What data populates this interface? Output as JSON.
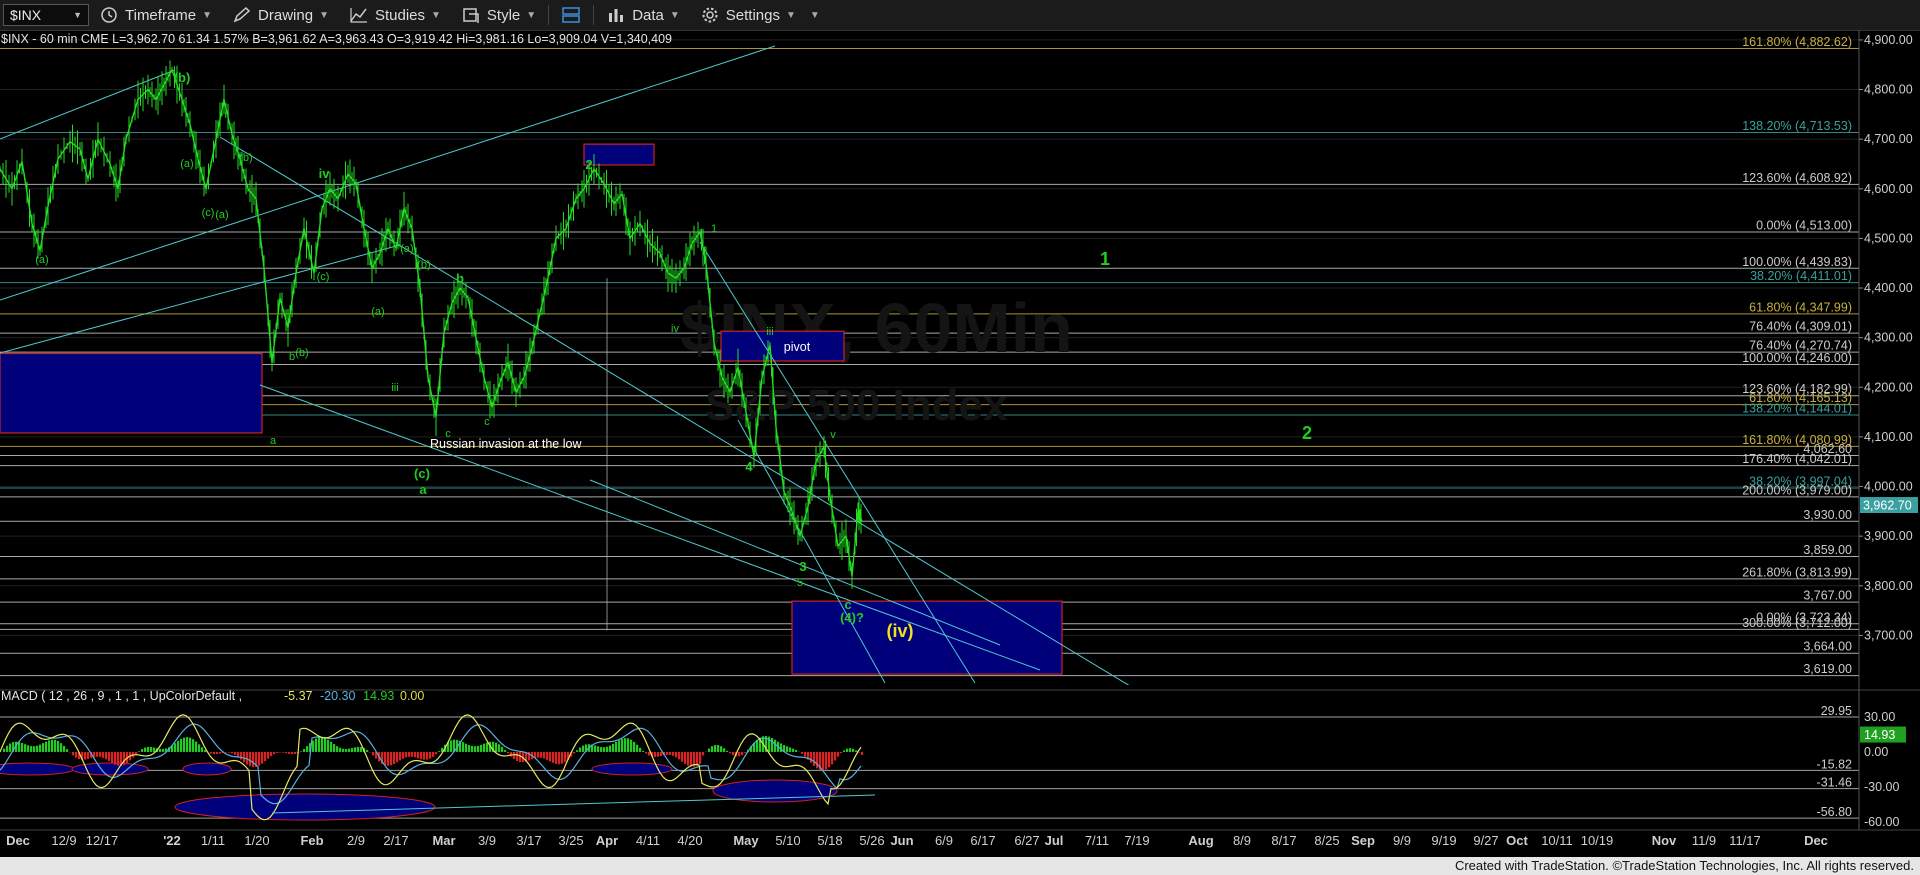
{
  "toolbar": {
    "symbol": "$INX",
    "timeframe_label": "Timeframe",
    "drawing_label": "Drawing",
    "studies_label": "Studies",
    "style_label": "Style",
    "data_label": "Data",
    "settings_label": "Settings"
  },
  "chart_header": {
    "text": "$INX - 60 min  CME  L=3,962.70  61.34  1.57%  B=3,961.62  A=3,963.43  O=3,919.42  Hi=3,981.16  Lo=3,909.04  V=1,340,409"
  },
  "watermark": {
    "line1": "$INX, 60Min",
    "line2": "S&P 500 Index"
  },
  "macd_header": {
    "label": "MACD ( 12 , 26 , 9 , 1 , 1 , UpColorDefault ,",
    "v1": "-5.37",
    "v2": "-20.30",
    "v3": "14.93",
    "v4": "0.00"
  },
  "footer": {
    "text": "Created with TradeStation. ©TradeStation Technologies, Inc. All rights reserved."
  },
  "colors": {
    "price": "#22dd22",
    "fib_line": "#c8c8c8",
    "fib_label": "#cccccc",
    "fib_gold": "#c8b040",
    "fib_teal": "#3aa0a0",
    "trend": "#4fc8d0",
    "box_fill": "#00007a",
    "box_border": "#cc2222",
    "wave_green": "#22cc22",
    "macd_line": "#e8e860",
    "macd_signal": "#5ab0e0",
    "hist_up": "#22cc22",
    "hist_down": "#dd2222"
  },
  "chart_data": {
    "type": "line",
    "title": "$INX, 60Min",
    "subtitle": "S&P 500 Index",
    "price_axis": {
      "ylim": [
        3600,
        4920
      ],
      "ticks": [
        3700,
        3800,
        3900,
        4000,
        4100,
        4200,
        4300,
        4400,
        4500,
        4600,
        4700,
        4800,
        4900
      ],
      "tick_labels": [
        "3,700.00",
        "3,800.00",
        "3,900.00",
        "4,000.00",
        "4,100.00",
        "4,200.00",
        "4,300.00",
        "4,400.00",
        "4,500.00",
        "4,600.00",
        "4,700.00",
        "4,800.00",
        "4,900.00"
      ],
      "last_price": {
        "value": 3962.7,
        "label": "3,962.70"
      }
    },
    "x_axis": {
      "tick_labels": [
        "Dec",
        "12/9",
        "12/17",
        "'22",
        "1/11",
        "1/20",
        "Feb",
        "2/9",
        "2/17",
        "Mar",
        "3/9",
        "3/17",
        "3/25",
        "Apr",
        "4/11",
        "4/20",
        "May",
        "5/10",
        "5/18",
        "5/26",
        "Jun",
        "6/9",
        "6/17",
        "6/27",
        "Jul",
        "7/11",
        "7/19",
        "Aug",
        "8/9",
        "8/17",
        "8/25",
        "Sep",
        "9/9",
        "9/19",
        "9/27",
        "Oct",
        "10/11",
        "10/19",
        "Nov",
        "11/9",
        "11/17",
        "Dec"
      ],
      "bold_labels": [
        "'22",
        "Feb",
        "Mar",
        "Apr",
        "May",
        "Jun",
        "Jul",
        "Aug",
        "Sep",
        "Oct",
        "Nov",
        "Dec"
      ]
    },
    "fib_levels": [
      {
        "value": 4882.62,
        "label": "161.80% (4,882.62)",
        "color": "gold"
      },
      {
        "value": 4713.53,
        "label": "138.20% (4,713.53)",
        "color": "teal"
      },
      {
        "value": 4608.92,
        "label": "123.60% (4,608.92)",
        "color": "white"
      },
      {
        "value": 4513.0,
        "label": "0.00% (4,513.00)",
        "color": "white"
      },
      {
        "value": 4439.83,
        "label": "100.00% (4,439.83)",
        "color": "white"
      },
      {
        "value": 4411.01,
        "label": "38.20% (4,411.01)",
        "color": "teal"
      },
      {
        "value": 4347.99,
        "label": "61.80% (4,347.99)",
        "color": "gold"
      },
      {
        "value": 4309.01,
        "label": "76.40% (4,309.01)",
        "color": "white"
      },
      {
        "value": 4270.74,
        "label": "76.40% (4,270.74)",
        "color": "white"
      },
      {
        "value": 4246.0,
        "label": "100.00% (4,246.00)",
        "color": "white"
      },
      {
        "value": 4182.99,
        "label": "123.60% (4,182.99)",
        "color": "white"
      },
      {
        "value": 4165.13,
        "label": "61.80% (4,165.13)",
        "color": "gold"
      },
      {
        "value": 4144.01,
        "label": "138.20% (4,144.01)",
        "color": "teal"
      },
      {
        "value": 4080.99,
        "label": "161.80% (4,080.99)",
        "color": "gold"
      },
      {
        "value": 4062.6,
        "label": "4,062.60",
        "color": "white"
      },
      {
        "value": 4042.01,
        "label": "176.40% (4,042.01)",
        "color": "white"
      },
      {
        "value": 3997.04,
        "label": "38.20% (3,997.04)",
        "color": "teal"
      },
      {
        "value": 3979.0,
        "label": "200.00% (3,979.00)",
        "color": "white"
      },
      {
        "value": 3930.0,
        "label": "3,930.00",
        "color": "white"
      },
      {
        "value": 3859.0,
        "label": "3,859.00",
        "color": "white"
      },
      {
        "value": 3813.99,
        "label": "261.80% (3,813.99)",
        "color": "white"
      },
      {
        "value": 3767.0,
        "label": "3,767.00",
        "color": "white"
      },
      {
        "value": 3723.34,
        "label": "0.00% (3,723.34)",
        "color": "white"
      },
      {
        "value": 3712.0,
        "label": "300.00% (3,712.00)",
        "color": "white"
      },
      {
        "value": 3664.0,
        "label": "3,664.00",
        "color": "white"
      },
      {
        "value": 3619.0,
        "label": "3,619.00",
        "color": "white"
      }
    ],
    "wave_labels": [
      {
        "text": "(a)",
        "color": "green",
        "size": "small"
      },
      {
        "text": "(b)",
        "color": "green",
        "size": "mid"
      },
      {
        "text": "ii",
        "color": "green",
        "size": "small"
      },
      {
        "text": "(a)",
        "color": "green",
        "size": "small"
      },
      {
        "text": "(b)",
        "color": "green",
        "size": "small"
      },
      {
        "text": "(c)",
        "color": "green",
        "size": "small"
      },
      {
        "text": "(a)",
        "color": "green",
        "size": "small"
      },
      {
        "text": "iv",
        "color": "green",
        "size": "mid"
      },
      {
        "text": "(a)",
        "color": "green",
        "size": "small"
      },
      {
        "text": "(b)",
        "color": "green",
        "size": "small"
      },
      {
        "text": "(c)",
        "color": "green",
        "size": "small"
      },
      {
        "text": "iii",
        "color": "green",
        "size": "small"
      },
      {
        "text": "(a)",
        "color": "green",
        "size": "small"
      },
      {
        "text": "(b)",
        "color": "green",
        "size": "small"
      },
      {
        "text": "a",
        "color": "green",
        "size": "small"
      },
      {
        "text": "b",
        "color": "green",
        "size": "small"
      },
      {
        "text": "c",
        "color": "green",
        "size": "small"
      },
      {
        "text": "(c)",
        "color": "green",
        "size": "mid"
      },
      {
        "text": "a",
        "color": "green",
        "size": "mid"
      },
      {
        "text": "b",
        "color": "green",
        "size": "mid"
      },
      {
        "text": "c",
        "color": "green",
        "size": "small"
      },
      {
        "text": "2",
        "color": "green",
        "size": "mid"
      },
      {
        "text": "1",
        "color": "green",
        "size": "small"
      },
      {
        "text": "iv",
        "color": "green",
        "size": "small"
      },
      {
        "text": "iii",
        "color": "green",
        "size": "small"
      },
      {
        "text": "4",
        "color": "green",
        "size": "mid"
      },
      {
        "text": "v",
        "color": "green",
        "size": "small"
      },
      {
        "text": "3",
        "color": "green",
        "size": "mid"
      },
      {
        "text": "5",
        "color": "green",
        "size": "small"
      },
      {
        "text": "c",
        "color": "green",
        "size": "mid"
      },
      {
        "text": "(4)?",
        "color": "green",
        "size": "mid"
      },
      {
        "text": "(iv)",
        "color": "yellow",
        "size": "big"
      },
      {
        "text": "1",
        "color": "green",
        "size": "big"
      },
      {
        "text": "2",
        "color": "green",
        "size": "big"
      }
    ],
    "annotations": [
      {
        "text": "Russian invasion at the low"
      },
      {
        "text": "pivot"
      }
    ],
    "macd": {
      "fast": 12,
      "slow": 26,
      "signal": 9,
      "ylim": [
        -67,
        36
      ],
      "ticks": [
        30,
        0,
        -30,
        -60
      ],
      "tick_labels": [
        "30.00",
        "0.00",
        "-30.00",
        "-60.00"
      ],
      "levels": [
        {
          "value": 29.95,
          "label": "29.95"
        },
        {
          "value": -15.82,
          "label": "-15.82"
        },
        {
          "value": -31.46,
          "label": "-31.46"
        },
        {
          "value": -56.8,
          "label": "-56.80"
        }
      ],
      "last_value": {
        "value": 14.93,
        "label": "14.93"
      }
    }
  }
}
